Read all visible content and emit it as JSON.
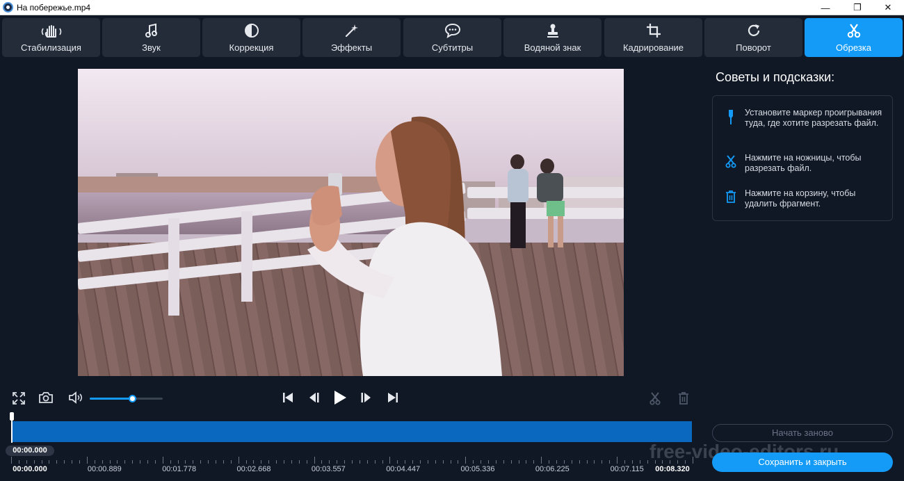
{
  "window": {
    "title": "На побережье.mp4",
    "minimize": "—",
    "maximize": "❐",
    "close": "✕"
  },
  "toolbar": {
    "tools": [
      {
        "label": "Стабилизация",
        "icon": "hand-stabilize-icon"
      },
      {
        "label": "Звук",
        "icon": "music-note-icon"
      },
      {
        "label": "Коррекция",
        "icon": "contrast-icon"
      },
      {
        "label": "Эффекты",
        "icon": "magic-wand-icon"
      },
      {
        "label": "Субтитры",
        "icon": "speech-bubble-icon"
      },
      {
        "label": "Водяной знак",
        "icon": "stamp-icon"
      },
      {
        "label": "Кадрирование",
        "icon": "crop-icon"
      },
      {
        "label": "Поворот",
        "icon": "rotate-icon"
      },
      {
        "label": "Обрезка",
        "icon": "scissors-icon",
        "active": true
      }
    ]
  },
  "tips": {
    "title": "Советы и подсказки:",
    "items": [
      {
        "icon": "marker-icon",
        "text": "Установите маркер проигрывания туда, где хотите разрезать файл."
      },
      {
        "icon": "scissors-icon",
        "text": "Нажмите на ножницы, чтобы разрезать файл."
      },
      {
        "icon": "trash-icon",
        "text": "Нажмите на корзину, чтобы удалить фрагмент."
      }
    ]
  },
  "buttons": {
    "restart": "Начать заново",
    "save_close": "Сохранить и закрыть"
  },
  "watermark": "free-video-editors.ru",
  "player": {
    "volume_fraction": 0.58,
    "current_time": "00:00.000"
  },
  "timeline": {
    "ticks": [
      "00:00.000",
      "00:00.889",
      "00:01.778",
      "00:02.668",
      "00:03.557",
      "00:04.447",
      "00:05.336",
      "00:06.225",
      "00:07.115",
      "00:08.320"
    ]
  },
  "colors": {
    "accent": "#139bf7",
    "background": "#101826",
    "tool_bg": "#242c39",
    "timeline_track": "#0b68bf"
  }
}
